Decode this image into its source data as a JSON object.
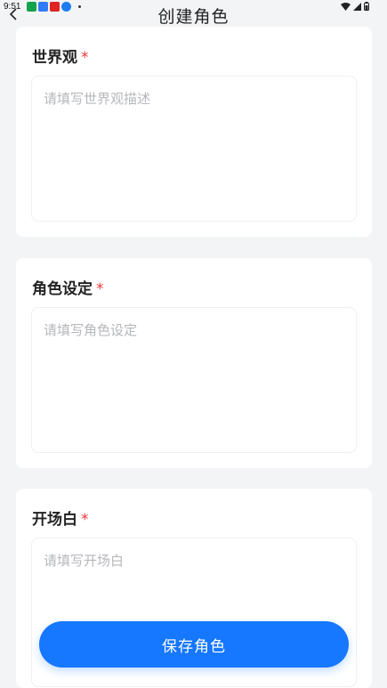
{
  "status_bar": {
    "time": "9:51",
    "app_icons": [
      "app-green-icon",
      "app-blue-icon",
      "app-red-icon",
      "download-icon"
    ],
    "system_icons": [
      "wifi-icon",
      "signal-icon",
      "battery-icon"
    ]
  },
  "header": {
    "title": "创建角色",
    "back_icon": "chevron-left-icon"
  },
  "form": {
    "fields": [
      {
        "label": "世界观",
        "required": "*",
        "placeholder": "请填写世界观描述"
      },
      {
        "label": "角色设定",
        "required": "*",
        "placeholder": "请填写角色设定"
      },
      {
        "label": "开场白",
        "required": "*",
        "placeholder": "请填写开场白"
      }
    ]
  },
  "actions": {
    "save_label": "保存角色"
  },
  "colors": {
    "accent": "#1677ff",
    "required": "#e53935",
    "background": "#f3f4f6"
  }
}
